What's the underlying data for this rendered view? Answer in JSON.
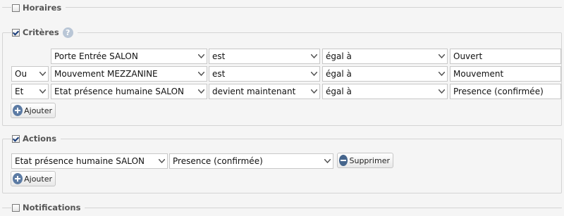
{
  "sections": {
    "horaires": {
      "label": "Horaires",
      "checked": false
    },
    "criteres": {
      "label": "Critères",
      "checked": true,
      "rows": [
        {
          "connector": "",
          "device": "Porte Entrée SALON",
          "operator": "est",
          "comparison": "égal à",
          "value": "Ouvert"
        },
        {
          "connector": "Ou",
          "device": "Mouvement MEZZANINE",
          "operator": "est",
          "comparison": "égal à",
          "value": "Mouvement"
        },
        {
          "connector": "Et",
          "device": "Etat présence humaine SALON",
          "operator": "devient maintenant",
          "comparison": "égal à",
          "value": "Presence (confirmée)"
        }
      ],
      "add_label": "Ajouter"
    },
    "actions": {
      "label": "Actions",
      "checked": true,
      "rows": [
        {
          "device": "Etat présence humaine SALON",
          "value": "Presence (confirmée)",
          "delete_label": "Supprimer"
        }
      ],
      "add_label": "Ajouter"
    },
    "notifications": {
      "label": "Notifications",
      "checked": false
    }
  },
  "icons": {
    "help": "help-icon",
    "add": "plus-circle-icon",
    "remove": "minus-circle-icon",
    "dropdown": "chevron-down-icon"
  }
}
